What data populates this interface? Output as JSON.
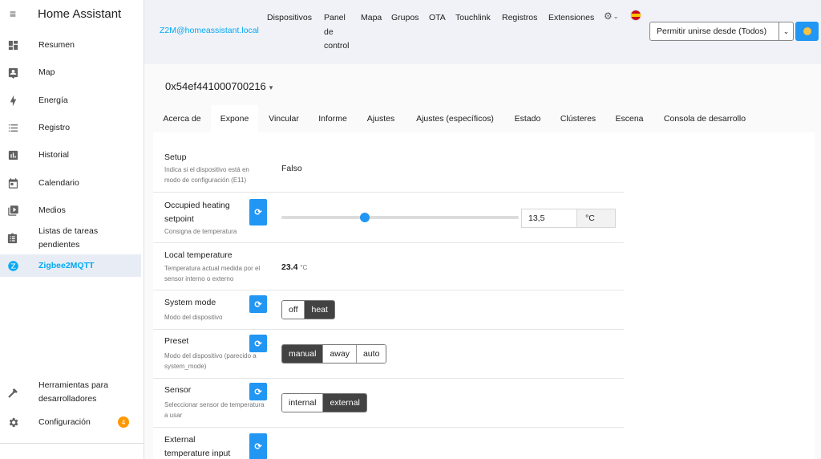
{
  "sidebar": {
    "title": "Home Assistant",
    "items": [
      {
        "label": "Resumen",
        "icon": "dashboard-icon"
      },
      {
        "label": "Map",
        "icon": "map-account-icon"
      },
      {
        "label": "Energía",
        "icon": "lightning-bolt-icon"
      },
      {
        "label": "Registro",
        "icon": "format-list-icon"
      },
      {
        "label": "Historial",
        "icon": "chart-box-icon"
      },
      {
        "label": "Calendario",
        "icon": "calendar-icon"
      },
      {
        "label": "Medios",
        "icon": "play-box-multiple-icon"
      },
      {
        "label": "Listas de tareas pendientes",
        "icon": "clipboard-list-icon"
      },
      {
        "label": "Zigbee2MQTT",
        "icon": "zigbee-icon",
        "active": true
      }
    ],
    "bottom_items": [
      {
        "label_line1": "Herramientas para",
        "label_line2": "desarrolladores",
        "icon": "hammer-icon"
      },
      {
        "label": "Configuración",
        "icon": "gear-icon",
        "badge": "4"
      }
    ]
  },
  "topbar": {
    "brand": "Z2M@homeassistant.local",
    "nav": {
      "dispositivos": "Dispositivos",
      "panel_1": "Panel",
      "panel_2": "de",
      "panel_3": "control",
      "mapa": "Mapa",
      "grupos": "Grupos",
      "ota": "OTA",
      "touchlink": "Touchlink",
      "registros": "Registros",
      "extensiones": "Extensiones"
    },
    "permit_join_label": "Permitir unirse desde (Todos)"
  },
  "device": {
    "name": "0x54ef441000700216"
  },
  "tabs": [
    {
      "label": "Acerca de"
    },
    {
      "label": "Expone",
      "active": true
    },
    {
      "label": "Vincular"
    },
    {
      "label": "Informe"
    },
    {
      "label": "Ajustes"
    },
    {
      "label": "Ajustes (específicos)"
    },
    {
      "label": "Estado"
    },
    {
      "label": "Clústeres"
    },
    {
      "label": "Escena"
    },
    {
      "label": "Consola de desarrollo"
    }
  ],
  "exposes": {
    "setup": {
      "title": "Setup",
      "desc": "Indica si el dispositivo está en modo de configuración (E11)",
      "value": "Falso"
    },
    "occupied_heating": {
      "title_1": "Occupied heating",
      "title_2": "setpoint",
      "desc": "Consigna de temperatura",
      "value": "13,5",
      "unit": "°C",
      "slider_fraction": 0.35
    },
    "local_temperature": {
      "title": "Local temperature",
      "desc": "Temperatura actual medida por el sensor interno o externo",
      "value": "23.4",
      "unit": "°C"
    },
    "system_mode": {
      "title": "System mode",
      "desc": "Modo del dispositivo",
      "options": [
        "off",
        "heat"
      ],
      "selected": "heat"
    },
    "preset": {
      "title": "Preset",
      "desc": "Modo del dispositivo (parecido a system_mode)",
      "options": [
        "manual",
        "away",
        "auto"
      ],
      "selected": "manual"
    },
    "sensor": {
      "title": "Sensor",
      "desc": "Seleccionar sensor de temperatura a usar",
      "options": [
        "internal",
        "external"
      ],
      "selected": "external"
    },
    "external_temp": {
      "title_1": "External",
      "title_2": "temperature input"
    }
  },
  "colors": {
    "accent": "#03a9f4",
    "primary_button": "#2196f3",
    "selected_option": "#424242",
    "badge": "#ff9800"
  }
}
